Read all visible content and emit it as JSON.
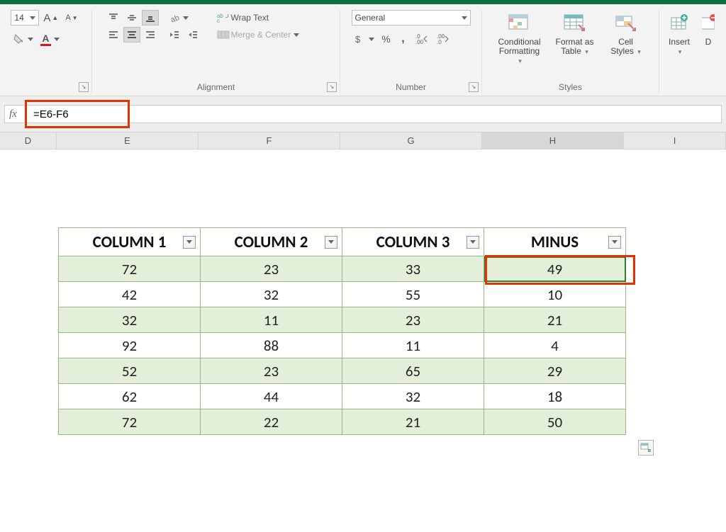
{
  "ribbon": {
    "font": {
      "size": "14"
    },
    "alignment": {
      "wrap_text": "Wrap Text",
      "merge_center": "Merge & Center",
      "group_label": "Alignment"
    },
    "number": {
      "format": "General",
      "group_label": "Number"
    },
    "styles": {
      "cond_fmt_label1": "Conditional",
      "cond_fmt_label2": "Formatting",
      "fmt_table_label1": "Format as",
      "fmt_table_label2": "Table",
      "cell_styles_label1": "Cell",
      "cell_styles_label2": "Styles",
      "group_label": "Styles"
    },
    "cells": {
      "insert_label": "Insert",
      "delete_label": "D"
    }
  },
  "formula": "=E6-F6",
  "columns": [
    "D",
    "E",
    "F",
    "G",
    "H",
    "I"
  ],
  "active_column": "H",
  "table": {
    "headers": [
      "COLUMN 1",
      "COLUMN 2",
      "COLUMN 3",
      "MINUS"
    ],
    "rows": [
      [
        72,
        23,
        33,
        49
      ],
      [
        42,
        32,
        55,
        10
      ],
      [
        32,
        11,
        23,
        21
      ],
      [
        92,
        88,
        11,
        4
      ],
      [
        52,
        23,
        65,
        29
      ],
      [
        62,
        44,
        32,
        18
      ],
      [
        72,
        22,
        21,
        50
      ]
    ]
  },
  "chart_data": {
    "type": "table",
    "title": "",
    "columns": [
      "COLUMN 1",
      "COLUMN 2",
      "COLUMN 3",
      "MINUS"
    ],
    "rows": [
      [
        72,
        23,
        33,
        49
      ],
      [
        42,
        32,
        55,
        10
      ],
      [
        32,
        11,
        23,
        21
      ],
      [
        92,
        88,
        11,
        4
      ],
      [
        52,
        23,
        65,
        29
      ],
      [
        62,
        44,
        32,
        18
      ],
      [
        72,
        22,
        21,
        50
      ]
    ],
    "formula_shown": "=E6-F6",
    "selected_cell": "H6"
  }
}
